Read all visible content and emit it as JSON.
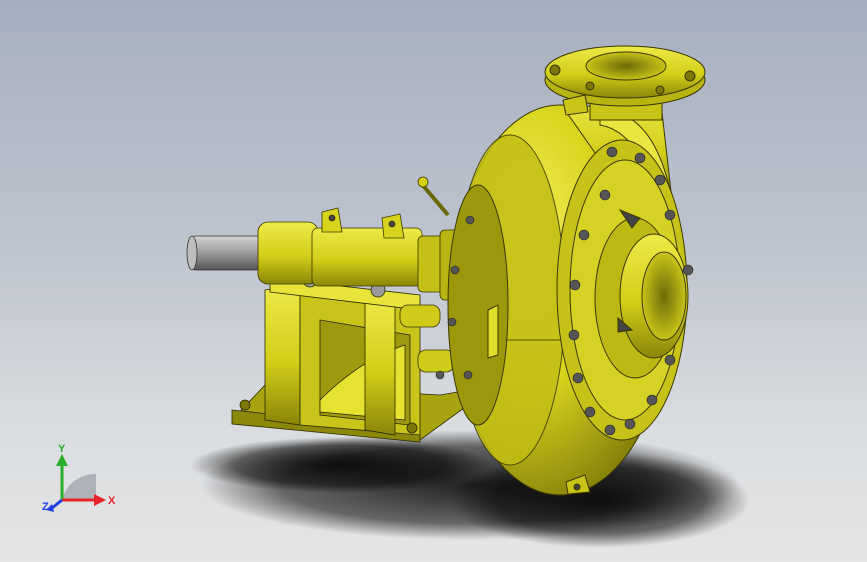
{
  "scene": {
    "model": "slurry-pump-assembly",
    "background_top": "#a6afc0",
    "background_bottom": "#e4e5e6",
    "body_color": "#d6d21a",
    "shaft_color": "#8a8a8a"
  },
  "triad": {
    "x_label": "X",
    "y_label": "Y",
    "z_label": "Z",
    "x_color": "#e8262a",
    "y_color": "#2ab02a",
    "z_color": "#2040e0"
  }
}
